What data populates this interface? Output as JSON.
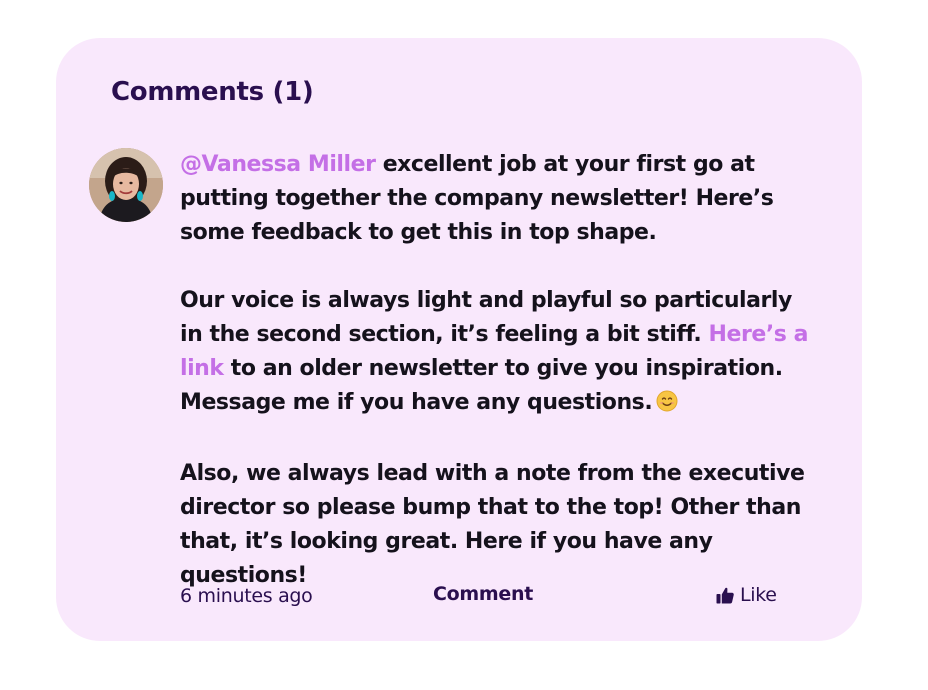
{
  "comments": {
    "title": "Comments (1)",
    "items": [
      {
        "avatar_icon": "user-avatar-photo",
        "mention": "@Vanessa Miller",
        "paragraph1_rest": " excellent job at your first go at putting together the company newsletter! Here’s some feedback to get this in top shape.",
        "paragraph2_before_link": "Our voice is always light and playful so particularly in the second section, it’s feeling a bit stiff. ",
        "link_text": "Here’s a link",
        "paragraph2_after_link": " to an older newsletter to give you inspiration. Message me if you have any questions.",
        "emoji_icon": "smiling-face-emoji",
        "paragraph3": "Also, we always lead with a note from the executive director so please bump that to the top! Other than that, it’s looking great. Here if you have any questions!",
        "timestamp": "6 minutes ago",
        "comment_label": "Comment",
        "like_label": "Like",
        "like_icon": "thumbs-up-icon"
      }
    ]
  },
  "colors": {
    "card_background": "#f9e8fc",
    "title": "#2a0f4f",
    "accent": "#c46fe6",
    "text": "#15121c"
  }
}
